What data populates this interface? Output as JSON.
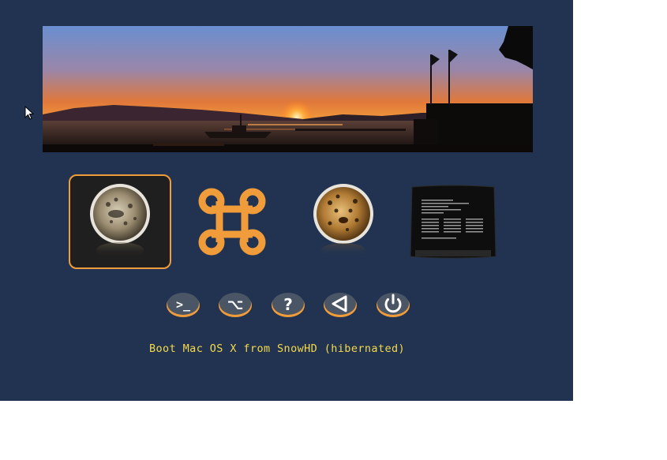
{
  "boot_entries": [
    {
      "label": "Mac OS X Snow Leopard volume",
      "icon": "snow-leopard-icon",
      "selected": true
    },
    {
      "label": "Mac OS X command volume",
      "icon": "command-key-icon",
      "selected": false
    },
    {
      "label": "Mac OS X Leopard volume",
      "icon": "leopard-icon",
      "selected": false
    },
    {
      "label": "Verbose boot terminal",
      "icon": "terminal-screen-icon",
      "selected": false
    }
  ],
  "tools": [
    {
      "name": "shell",
      "icon": "shell-icon",
      "glyph": ">_"
    },
    {
      "name": "options",
      "icon": "option-key-icon",
      "glyph": "⌥"
    },
    {
      "name": "help",
      "icon": "help-icon",
      "glyph": "?"
    },
    {
      "name": "back",
      "icon": "back-triangle-icon",
      "glyph": "◁"
    },
    {
      "name": "shutdown",
      "icon": "power-icon",
      "glyph": "⏻"
    }
  ],
  "status_text": "Boot Mac OS X from SnowHD (hibernated)",
  "colors": {
    "background": "#213350",
    "accent": "#f09c3a",
    "status_text": "#f4d94b",
    "button_face": "#4a5566"
  }
}
